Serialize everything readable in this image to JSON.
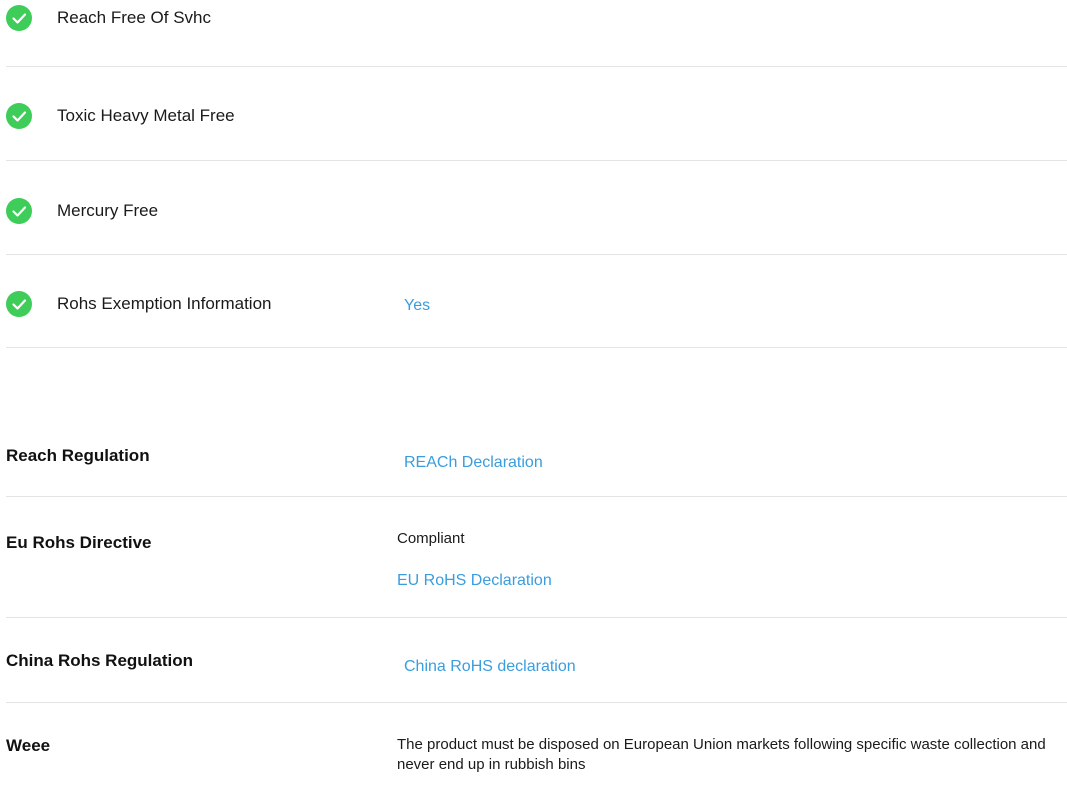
{
  "environmental_checks": [
    {
      "label": "Reach Free Of Svhc",
      "value": ""
    },
    {
      "label": "Toxic Heavy Metal Free",
      "value": ""
    },
    {
      "label": "Mercury Free",
      "value": ""
    },
    {
      "label": "Rohs Exemption Information",
      "value": "Yes"
    }
  ],
  "regulations": {
    "reach": {
      "label": "Reach Regulation",
      "link": "REACh Declaration"
    },
    "eu_rohs": {
      "label": "Eu Rohs Directive",
      "status": "Compliant",
      "link": "EU RoHS Declaration"
    },
    "china_rohs": {
      "label": "China Rohs Regulation",
      "link": "China RoHS declaration"
    },
    "weee": {
      "label": "Weee",
      "text": "The product must be disposed on European Union markets following specific waste collection and never end up in rubbish bins"
    }
  },
  "colors": {
    "check": "#3dcd58",
    "link": "#3a9dde",
    "divider": "#e4e4e4"
  }
}
